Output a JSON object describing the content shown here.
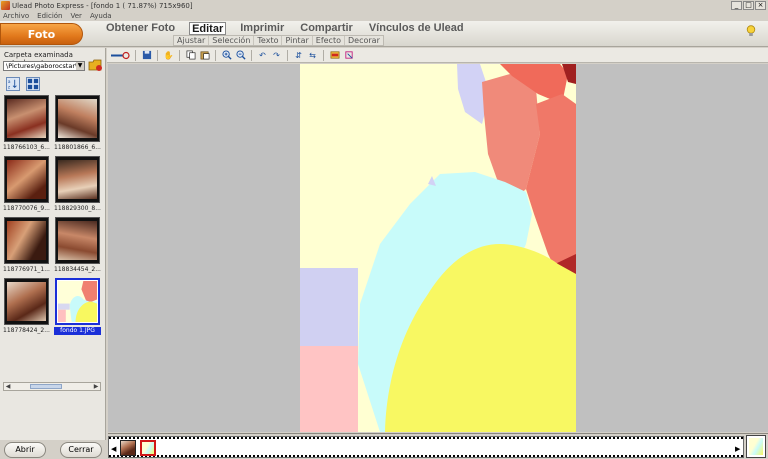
{
  "window": {
    "title": "Ulead Photo Express - [fondo 1 ( 71.87%) 715x960]",
    "controls": [
      "_",
      "□",
      "×"
    ]
  },
  "menu": [
    "Archivo",
    "Edición",
    "Ver",
    "Ayuda"
  ],
  "mode_button": "Foto",
  "main_tabs": [
    {
      "label": "Obtener Foto",
      "active": false
    },
    {
      "label": "Editar",
      "active": true
    },
    {
      "label": "Imprimir",
      "active": false
    },
    {
      "label": "Compartir",
      "active": false
    },
    {
      "label": "Vínculos de Ulead",
      "active": false
    }
  ],
  "sub_tabs": [
    "Ajustar",
    "Selección",
    "Texto",
    "Pintar",
    "Efecto",
    "Decorar"
  ],
  "left_panel": {
    "folder_label": "Carpeta examinada actualmente:",
    "folder_path": "\\Pictures\\gaborocstar\\",
    "thumbnails": [
      {
        "caption": "118766103_6...",
        "selected": false
      },
      {
        "caption": "118801866_6...",
        "selected": false
      },
      {
        "caption": "118770076_9...",
        "selected": false
      },
      {
        "caption": "118829300_8...",
        "selected": false
      },
      {
        "caption": "118776971_1...",
        "selected": false
      },
      {
        "caption": "118834454_2...",
        "selected": false
      },
      {
        "caption": "118778424_2...",
        "selected": false
      },
      {
        "caption": "fondo 1.JPG",
        "selected": true
      }
    ],
    "open_button": "Abrir",
    "close_button": "Cerrar"
  },
  "toolbar": {
    "tools": [
      "undo-history-icon",
      "save-icon",
      "hand-icon",
      "copy-icon",
      "paste-icon",
      "zoom-in-icon",
      "zoom-out-icon",
      "rotate-left-icon",
      "rotate-right-icon",
      "flip-vertical-icon",
      "flip-horizontal-icon",
      "image-info-icon",
      "crop-icon"
    ]
  },
  "colors": {
    "accent_orange": "#e2791c",
    "selection_blue": "#1a2fd8",
    "canvas_gray": "#c0c0c0"
  }
}
